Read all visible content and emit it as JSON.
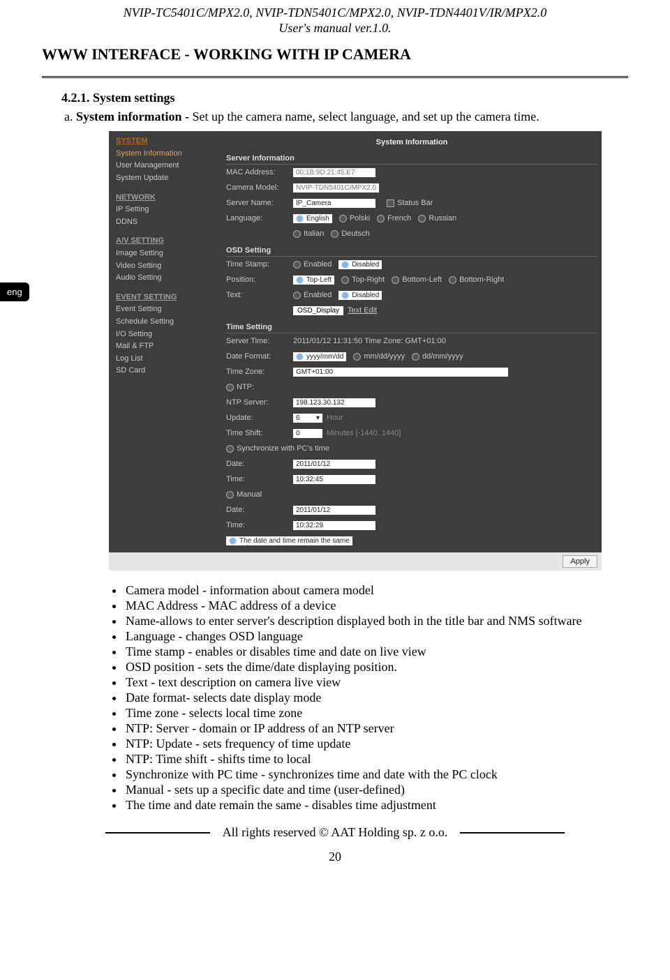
{
  "header": {
    "models": "NVIP-TC5401C/MPX2.0, NVIP-TDN5401C/MPX2.0, NVIP-TDN4401V/IR/MPX2.0",
    "manual": "User's manual ver.1.0."
  },
  "langTab": "eng",
  "sectionTitle": "WWW INTERFACE - WORKING WITH IP CAMERA",
  "subHeading": "4.2.1. System settings",
  "subItem": {
    "letter": "a.",
    "bold": "System information - ",
    "rest": "Set up the camera name, select language, and set up the camera time."
  },
  "ui": {
    "nav": {
      "system": "SYSTEM",
      "sys_items": [
        "System Information",
        "User Management",
        "System Update"
      ],
      "network": "NETWORK",
      "net_items": [
        "IP Setting",
        "DDNS"
      ],
      "av": "A/V SETTING",
      "av_items": [
        "Image Setting",
        "Video Setting",
        "Audio Setting"
      ],
      "event": "EVENT SETTING",
      "ev_items": [
        "Event Setting",
        "Schedule Setting",
        "I/O Setting",
        "Mail & FTP",
        "Log List",
        "SD Card"
      ]
    },
    "title": "System Information",
    "server": {
      "heading": "Server Information",
      "mac_lbl": "MAC Address:",
      "mac_val": "00:1B:9D:21:45:E7",
      "model_lbl": "Camera Model:",
      "model_val": "NVIP-TDN5401C/MPX2.0",
      "name_lbl": "Server Name:",
      "name_val": "IP_Camera",
      "status_lbl": "Status Bar",
      "lang_lbl": "Language:",
      "langs": [
        "English",
        "Polski",
        "French",
        "Russian",
        "Italian",
        "Deutsch"
      ]
    },
    "osd": {
      "heading": "OSD Setting",
      "ts_lbl": "Time Stamp:",
      "ts_opts": [
        "Enabled",
        "Disabled"
      ],
      "pos_lbl": "Position:",
      "pos_opts": [
        "Top-Left",
        "Top-Right",
        "Bottom-Left",
        "Bottom-Right"
      ],
      "txt_lbl": "Text:",
      "txt_opts": [
        "Enabled",
        "Disabled"
      ],
      "osd_val": "OSD_Display",
      "textedit": "Text Edit"
    },
    "time": {
      "heading": "Time Setting",
      "srvtime_lbl": "Server Time:",
      "srvtime_val": "2011/01/12 11:31:50 Time Zone: GMT+01:00",
      "datefmt_lbl": "Date Format:",
      "datefmt_opts": [
        "yyyy/mm/dd",
        "mm/dd/yyyy",
        "dd/mm/yyyy"
      ],
      "tz_lbl": "Time Zone:",
      "tz_val": "GMT+01:00",
      "ntp_lbl": "NTP:",
      "ntpsrv_lbl": "NTP Server:",
      "ntpsrv_val": "198.123.30.132",
      "update_lbl": "Update:",
      "update_val": "6",
      "update_unit": "Hour",
      "shift_lbl": "Time Shift:",
      "shift_val": "0",
      "shift_hint": "Minutes [-1440..1440]",
      "sync_lbl": "Synchronize with PC's time",
      "date_lbl": "Date:",
      "date1": "2011/01/12",
      "time_lbl": "Time:",
      "time1": "10:32:45",
      "manual_lbl": "Manual",
      "date2": "2011/01/12",
      "time2": "10:32:29",
      "same_lbl": "The date and time remain the same"
    },
    "apply": "Apply"
  },
  "bullets": [
    "Camera model - information about camera model",
    "MAC Address - MAC address of a device",
    "Name-allows to enter server's description displayed both in the title bar and NMS software",
    "Language - changes OSD language",
    "Time stamp - enables or disables time and date on live view",
    "OSD position - sets the dime/date displaying position.",
    "Text - text description on camera live view",
    "Date format- selects date display mode",
    "Time zone - selects local time zone",
    "NTP: Server - domain or IP address of an NTP server",
    "NTP: Update - sets frequency of time update",
    "NTP: Time shift - shifts time to local",
    "Synchronize with PC time - synchronizes time and date with the PC clock",
    "Manual - sets up a specific date and time (user-defined)",
    "The time and date remain the same - disables time adjustment"
  ],
  "footer": {
    "copy": "All rights reserved © AAT Holding sp. z o.o.",
    "page": "20"
  }
}
